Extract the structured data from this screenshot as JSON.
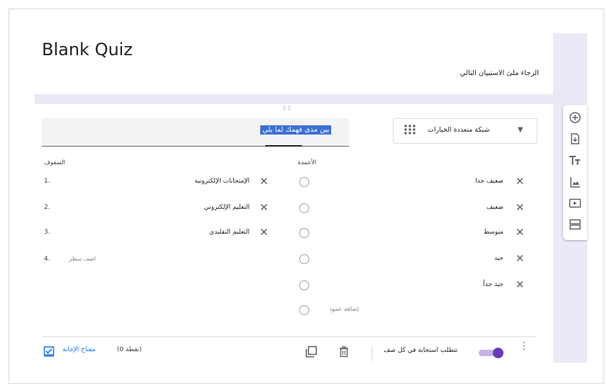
{
  "form": {
    "title": "Blank Quiz",
    "description": "الرجاء ملئ الاستبيان التالي"
  },
  "question": {
    "title": "بين مدى فهمك لما يلي",
    "type_label": "شبكة متعددة الخيارات",
    "drag_handle": "⠿⠿"
  },
  "rows": {
    "header": "الصفوف",
    "items": [
      {
        "number": "1.",
        "label": "الإمتحانات الإلكترونية"
      },
      {
        "number": "2.",
        "label": "التعليم الإلكتروني"
      },
      {
        "number": "3.",
        "label": "التعليم التقليدي"
      }
    ],
    "add_number": "4.",
    "add_label": "اضف سطر"
  },
  "columns": {
    "header": "الأعمدة",
    "items": [
      {
        "label": "ضعيف جدا"
      },
      {
        "label": "ضعيف"
      },
      {
        "label": "متوسط"
      },
      {
        "label": "جيد"
      },
      {
        "label": "جيد جداً"
      }
    ],
    "add_label": "إضافة عمود"
  },
  "footer": {
    "answer_key": "مفتاح الإجابة",
    "points": "(نقطة 0)",
    "require_label": "تتطلب استجابة في كل صف",
    "require_on": true
  },
  "sidebar_icons": [
    "add-question-icon",
    "import-questions-icon",
    "add-title-icon",
    "add-image-icon",
    "add-video-icon",
    "add-section-icon"
  ],
  "colors": {
    "accent": "#673ab7",
    "link": "#1a73e8",
    "background": "#ece8f6"
  }
}
